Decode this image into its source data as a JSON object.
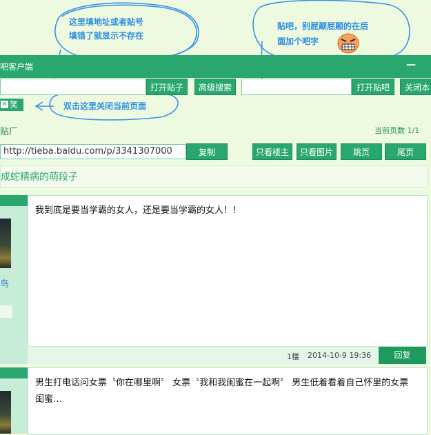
{
  "annotations": {
    "address_line1": "这里填地址或者贴号",
    "address_line2": "填错了就显示不存在",
    "bar_line1": "贴吧，别屁颠屁颠的在后",
    "bar_line2": "面加个吧字",
    "close_hint": "双击这里关闭当前页面",
    "emoji": "angry-face-icon"
  },
  "window": {
    "title": "吧客户端",
    "minimize": "—"
  },
  "toolbar": {
    "open_post": "打开贴子",
    "advanced_search": "高级搜索",
    "open_bar": "打开贴吧",
    "close_label": "关闭本"
  },
  "tab": {
    "label": "笑",
    "icon": "close-icon"
  },
  "page": {
    "title": "贴厂",
    "page_info": "当前页数 1/1"
  },
  "url_bar": {
    "url": "http://tieba.baidu.com/p/3341307000",
    "copy": "复制",
    "only_op": "只看楼主",
    "only_images": "只看图片",
    "jump": "跳页",
    "last_page": "尾页"
  },
  "thread": {
    "title": "成蛇精病的萌段子"
  },
  "posts": [
    {
      "user_fragment": "鸟",
      "text": "我到底是要当学霸的女人，还是要当学霸的女人！！",
      "floor": "1楼",
      "time": "2014-10-9 19:36",
      "reply": "回复"
    },
    {
      "text": "男生打电话问女票〝你在哪里啊〞 女票〝我和我闺蜜在一起啊〞 男生低着看着自己怀里的女票闺蜜…"
    }
  ],
  "colors": {
    "accent": "#2aa76f",
    "annotation": "#2e8ee0",
    "background": "#eefae0"
  }
}
